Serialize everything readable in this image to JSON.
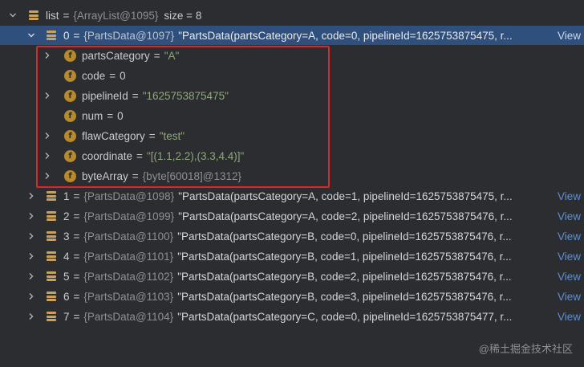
{
  "root": {
    "name": "list",
    "ref": "{ArrayList@1095}",
    "size_text": "size = 8"
  },
  "selected_item": {
    "index": "0",
    "ref": "{PartsData@1097}",
    "desc": "\"PartsData(partsCategory=A, code=0, pipelineId=1625753875475, r...",
    "view_label": "View"
  },
  "fields": [
    {
      "name": "partsCategory",
      "value": "\"A\"",
      "kind": "str",
      "expandable": true
    },
    {
      "name": "code",
      "value": "0",
      "kind": "num",
      "expandable": false
    },
    {
      "name": "pipelineId",
      "value": "\"1625753875475\"",
      "kind": "str",
      "expandable": true
    },
    {
      "name": "num",
      "value": "0",
      "kind": "num",
      "expandable": false
    },
    {
      "name": "flawCategory",
      "value": "\"test\"",
      "kind": "str",
      "expandable": true
    },
    {
      "name": "coordinate",
      "value": "\"[(1.1,2.2),(3.3,4.4)]\"",
      "kind": "str",
      "expandable": true
    },
    {
      "name": "byteArray",
      "value": "{byte[60018]@1312}",
      "kind": "ref",
      "expandable": true
    }
  ],
  "items": [
    {
      "index": "1",
      "ref": "{PartsData@1098}",
      "desc": "\"PartsData(partsCategory=A, code=1, pipelineId=1625753875475, r...",
      "view_label": "View"
    },
    {
      "index": "2",
      "ref": "{PartsData@1099}",
      "desc": "\"PartsData(partsCategory=A, code=2, pipelineId=1625753875476, r...",
      "view_label": "View"
    },
    {
      "index": "3",
      "ref": "{PartsData@1100}",
      "desc": "\"PartsData(partsCategory=B, code=0, pipelineId=1625753875476, r...",
      "view_label": "View"
    },
    {
      "index": "4",
      "ref": "{PartsData@1101}",
      "desc": "\"PartsData(partsCategory=B, code=1, pipelineId=1625753875476, r...",
      "view_label": "View"
    },
    {
      "index": "5",
      "ref": "{PartsData@1102}",
      "desc": "\"PartsData(partsCategory=B, code=2, pipelineId=1625753875476, r...",
      "view_label": "View"
    },
    {
      "index": "6",
      "ref": "{PartsData@1103}",
      "desc": "\"PartsData(partsCategory=B, code=3, pipelineId=1625753875476, r...",
      "view_label": "View"
    },
    {
      "index": "7",
      "ref": "{PartsData@1104}",
      "desc": "\"PartsData(partsCategory=C, code=0, pipelineId=1625753875477, r...",
      "view_label": "View"
    }
  ],
  "watermark": "@稀土掘金技术社区",
  "colors": {
    "background": "#2b2d30",
    "selection": "#2f4f7d",
    "highlight_border": "#e0252a",
    "field_icon": "#b78a2e",
    "list_icon": "#c9a15d",
    "string_value": "#8fa87a",
    "link": "#5e8fd4"
  }
}
